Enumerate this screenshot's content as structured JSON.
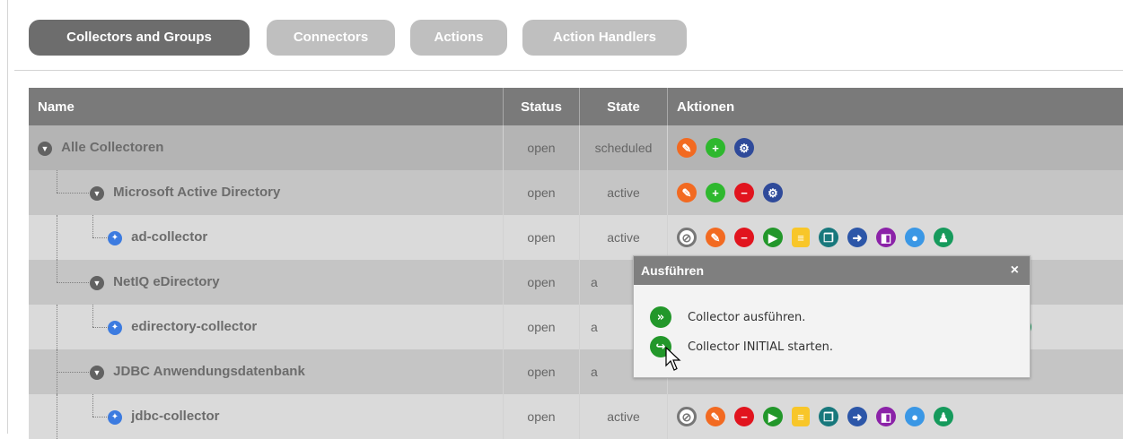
{
  "tabs": [
    {
      "label": "Collectors and Groups",
      "active": true
    },
    {
      "label": "Connectors",
      "active": false
    },
    {
      "label": "Actions",
      "active": false
    },
    {
      "label": "Action Handlers",
      "active": false
    }
  ],
  "table": {
    "headers": [
      "Name",
      "Status",
      "State",
      "Aktionen"
    ],
    "rows": [
      {
        "name": "Alle Collectoren",
        "status": "open",
        "state": "scheduled",
        "icons": [
          "edit-icon",
          "add-icon",
          "settings-icon"
        ]
      },
      {
        "name": "Microsoft Active Directory",
        "status": "open",
        "state": "active",
        "icons": [
          "edit-icon",
          "add-icon",
          "remove-icon",
          "settings-icon"
        ]
      },
      {
        "name": "ad-collector",
        "status": "open",
        "state": "active",
        "icons": [
          "disable-icon",
          "edit-icon",
          "remove-icon",
          "run-icon",
          "log-icon",
          "copy-icon",
          "next-icon",
          "export-icon",
          "info-icon",
          "user-icon"
        ]
      },
      {
        "name": "NetIQ eDirectory",
        "status": "open",
        "state": "a",
        "icons": []
      },
      {
        "name": "edirectory-collector",
        "status": "open",
        "state": "a",
        "icons": [
          "user-icon"
        ]
      },
      {
        "name": "JDBC Anwendungsdatenbank",
        "status": "open",
        "state": "a",
        "icons": []
      },
      {
        "name": "jdbc-collector",
        "status": "open",
        "state": "active",
        "icons": [
          "disable-icon",
          "edit-icon",
          "remove-icon",
          "run-icon",
          "log-icon",
          "copy-icon",
          "next-icon",
          "export-icon",
          "info-icon",
          "user-icon"
        ]
      }
    ]
  },
  "popup": {
    "title": "Ausführen",
    "close": "×",
    "items": [
      "Collector ausführen.",
      "Collector INITIAL starten."
    ]
  }
}
